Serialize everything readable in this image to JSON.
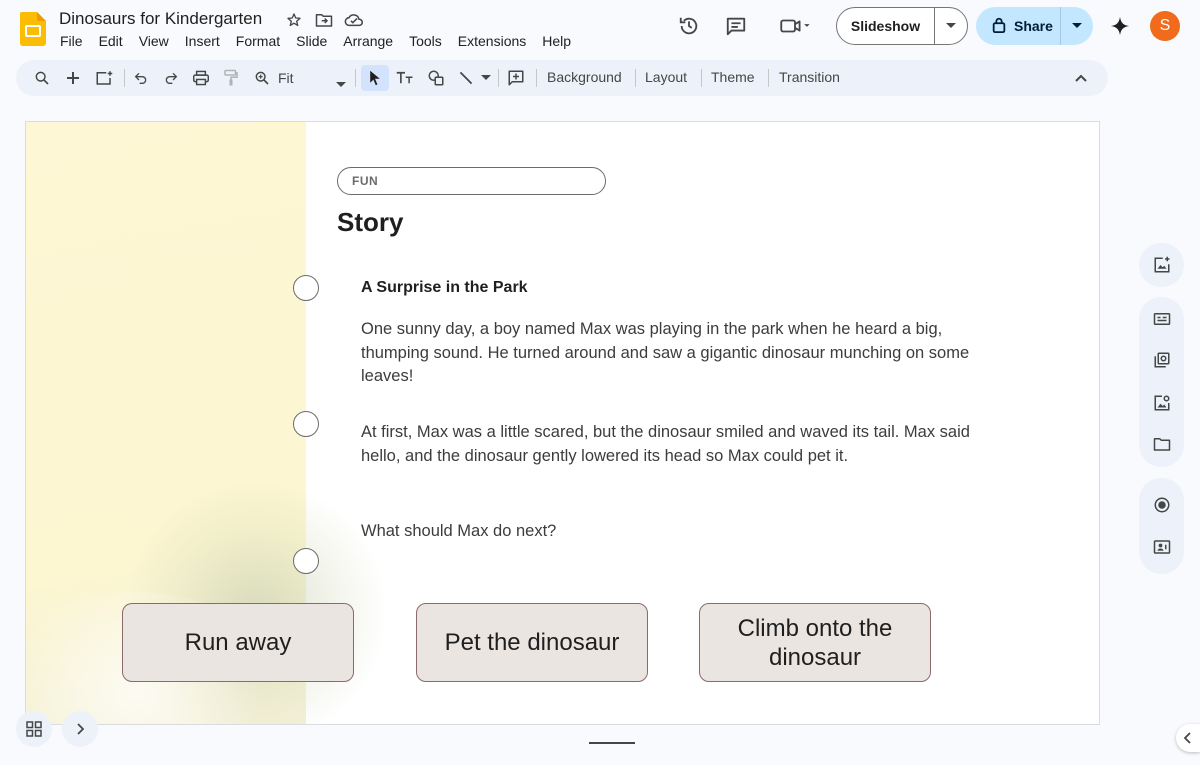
{
  "app": {
    "icon": "slides-logo-icon",
    "accent": "#fbbc04"
  },
  "document": {
    "title": "Dinosaurs for Kindergarten"
  },
  "menu": [
    "File",
    "Edit",
    "View",
    "Insert",
    "Format",
    "Slide",
    "Arrange",
    "Tools",
    "Extensions",
    "Help"
  ],
  "header": {
    "slideshow_label": "Slideshow",
    "share_label": "Share",
    "avatar_initial": "S",
    "avatar_color": "#f26a1b"
  },
  "toolbar": {
    "zoom_value": "Fit",
    "background_label": "Background",
    "layout_label": "Layout",
    "theme_label": "Theme",
    "transition_label": "Transition"
  },
  "slide": {
    "tag": "FUN",
    "heading": "Story",
    "story_title": "A Surprise in the Park",
    "paragraphs": [
      "One sunny day, a boy named Max was playing in the park when he heard a big, thumping sound. He turned around and saw a gigantic dinosaur munching on some leaves!",
      "At first, Max was a little scared, but the dinosaur smiled and waved its tail. Max said hello, and the dinosaur gently lowered its head so Max could pet it.",
      "What should Max do next?"
    ],
    "choices": [
      "Run away",
      "Pet the dinosaur",
      "Climb onto the dinosaur"
    ]
  }
}
